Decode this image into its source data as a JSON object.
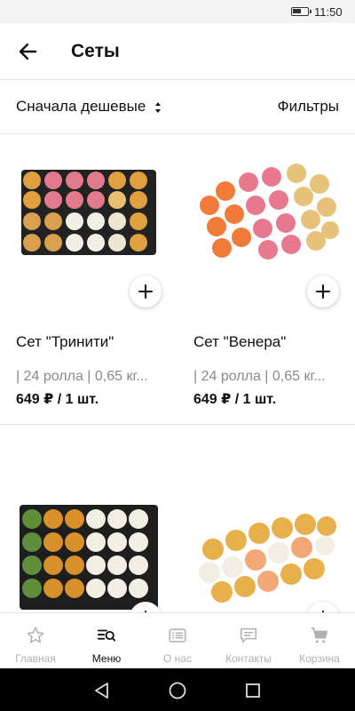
{
  "status_bar": {
    "time": "11:50"
  },
  "header": {
    "title": "Сеты",
    "back_icon": "arrow-left-icon"
  },
  "toolbar": {
    "sort_label": "Сначала дешевые",
    "filter_label": "Фильтры"
  },
  "products": [
    {
      "name": "Сет \"Тринити\"",
      "description": "| 24 ролла | 0,65 кг...",
      "price": "649 ₽ / 1 шт."
    },
    {
      "name": "Сет \"Венера\"",
      "description": "| 24 ролла | 0,65 кг...",
      "price": "649 ₽ / 1 шт."
    },
    {
      "name": "",
      "description": "",
      "price": ""
    },
    {
      "name": "",
      "description": "",
      "price": ""
    }
  ],
  "bottom_nav": {
    "items": [
      {
        "label": "Главная",
        "icon": "star-icon",
        "active": false
      },
      {
        "label": "Меню",
        "icon": "menu-search-icon",
        "active": true
      },
      {
        "label": "О нас",
        "icon": "info-card-icon",
        "active": false
      },
      {
        "label": "Контакты",
        "icon": "chat-icon",
        "active": false
      },
      {
        "label": "Корзина",
        "icon": "cart-icon",
        "active": false
      }
    ]
  },
  "colors": {
    "text": "#111111",
    "muted": "#8a8a8a",
    "nav_inactive": "#b0b0b0",
    "divider": "#e6e6e6"
  }
}
